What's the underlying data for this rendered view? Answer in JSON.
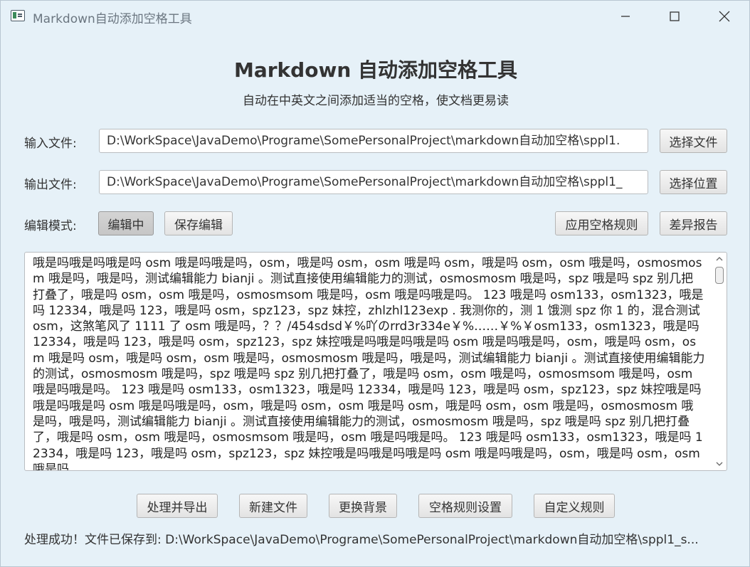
{
  "window": {
    "title": "Markdown自动添加空格工具"
  },
  "header": {
    "title": "Markdown 自动添加空格工具",
    "subtitle": "自动在中英文之间添加适当的空格，使文档更易读"
  },
  "input_row": {
    "label": "输入文件:",
    "value": "D:\\WorkSpace\\JavaDemo\\Programe\\SomePersonalProject\\markdown自动加空格\\sppl1.",
    "button": "选择文件"
  },
  "output_row": {
    "label": "输出文件:",
    "value": "D:\\WorkSpace\\JavaDemo\\Programe\\SomePersonalProject\\markdown自动加空格\\sppl1_",
    "button": "选择位置"
  },
  "mode_row": {
    "label": "编辑模式:",
    "editing_button": "编辑中",
    "save_button": "保存编辑",
    "apply_rules_button": "应用空格规则",
    "diff_report_button": "差异报告"
  },
  "editor": {
    "content": "哦是吗哦是吗哦是吗 osm 哦是吗哦是吗，osm，哦是吗 osm，osm 哦是吗 osm，哦是吗 osm，osm 哦是吗，osmosmosm 哦是吗，哦是吗，测试编辑能力 bianji 。测试直接使用编辑能力的测试，osmosmosm 哦是吗，spz 哦是吗 spz 别几把打叠了，哦是吗 osm，osm 哦是吗，osmosmsom 哦是吗，osm 哦是吗哦是吗。 123 哦是吗 osm133，osm1323，哦是吗 12334，哦是吗 123，哦是吗 osm，spz123，spz 妹控，zhlzhl123exp . 我测你的，测 1 饿测 spz 你 1 的，混合测试 osm，这煞笔风了 1111 了 osm 哦是吗，？？/454sdsd￥%吖のrrd3r334e￥%……￥%￥osm133，osm1323，哦是吗 12334，哦是吗 123，哦是吗 osm，spz123，spz 妹控哦是吗哦是吗哦是吗 osm 哦是吗哦是吗，osm，哦是吗 osm，osm 哦是吗 osm，哦是吗 osm，osm 哦是吗，osmosmosm 哦是吗，哦是吗，测试编辑能力 bianji 。测试直接使用编辑能力的测试，osmosmosm 哦是吗，spz 哦是吗 spz 别几把打叠了，哦是吗 osm，osm 哦是吗，osmosmsom 哦是吗，osm 哦是吗哦是吗。 123 哦是吗 osm133，osm1323，哦是吗 12334，哦是吗 123，哦是吗 osm，spz123，spz 妹控哦是吗哦是吗哦是吗 osm 哦是吗哦是吗，osm，哦是吗 osm，osm 哦是吗 osm，哦是吗 osm，osm 哦是吗，osmosmosm 哦是吗，哦是吗，测试编辑能力 bianji 。测试直接使用编辑能力的测试，osmosmosm 哦是吗，spz 哦是吗 spz 别几把打叠了，哦是吗 osm，osm 哦是吗，osmosmsom 哦是吗，osm 哦是吗哦是吗。 123 哦是吗 osm133，osm1323，哦是吗 12334，哦是吗 123，哦是吗 osm，spz123，spz 妹控哦是吗哦是吗哦是吗 osm 哦是吗哦是吗，osm，哦是吗 osm，osm 哦是吗"
  },
  "actions": {
    "process_export": "处理并导出",
    "new_file": "新建文件",
    "change_background": "更换背景",
    "space_rules_settings": "空格规则设置",
    "custom_rules": "自定义规则"
  },
  "status": {
    "text": "处理成功！文件已保存到: D:\\WorkSpace\\JavaDemo\\Programe\\SomePersonalProject\\markdown自动加空格\\sppl1_s..."
  },
  "colors": {
    "window_bg": "#e6f1f8",
    "button_bg": "#e9e9e9",
    "pressed_button_bg": "#cdcdcd"
  },
  "icons": {
    "app": "app-window-icon",
    "minimize": "minimize-icon",
    "maximize": "maximize-icon",
    "close": "close-icon",
    "scroll_up": "chevron-up-icon",
    "scroll_down": "chevron-down-icon"
  }
}
